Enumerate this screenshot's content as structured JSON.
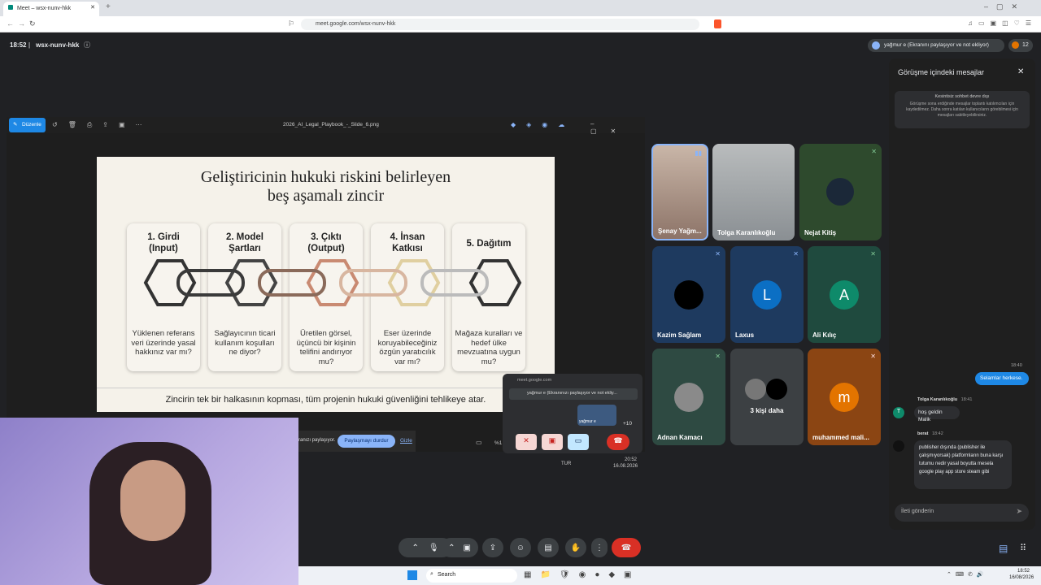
{
  "browser": {
    "tab_title": "Meet – wsx-nunv-hkk",
    "url": "meet.google.com/wsx-nunv-hkk"
  },
  "meet": {
    "time": "18:52",
    "meeting_code": "wsx-nunv-hkk",
    "presenter_pill": "yağmur e (Ekranını paylaşıyor ve not ekliyor)",
    "participant_count": "12"
  },
  "share_window": {
    "edit_label": "Düzenle",
    "file_name": "2026_AI_Legal_Playbook_-_Slide_6.png"
  },
  "slide": {
    "title_line1": "Geliştiricinin hukuki riskini belirleyen",
    "title_line2": "beş aşamalı zincir",
    "cards": [
      {
        "title": "1. Girdi\n(Input)",
        "question": "Yüklenen referans veri üzerinde yasal hakkınız var mı?"
      },
      {
        "title": "2. Model\nŞartları",
        "question": "Sağlayıcının ticari kullanım koşulları ne diyor?"
      },
      {
        "title": "3. Çıktı\n(Output)",
        "question": "Üretilen görsel, üçüncü bir kişinin telifini andırıyor mu?"
      },
      {
        "title": "4. İnsan\nKatkısı",
        "question": "Eser üzerinde koruyabileceğiniz özgün yaratıcılık var mı?"
      },
      {
        "title": "5. Dağıtım",
        "question": "Mağaza kuralları ve hedef ülke mevzuatına uygun mu?"
      }
    ],
    "footer": "Zincirin tek bir halkasının kopması, tüm projenin hukuki güvenliğini tehlikeye atar."
  },
  "sharebar": {
    "text": "ranızı paylaşıyor.",
    "stop_button": "Paylaşmayı durdur",
    "hide_button": "Gizle",
    "zoom": "%1"
  },
  "mini_popup": {
    "domain": "meet.google.com",
    "presenter": "yağmur e (Ekranınızı paylaşıyor ve not ekliy...",
    "self_label": "yağmur e",
    "more_count": "+10",
    "lang": "TUR",
    "time": "20:52",
    "date": "16.08.2026"
  },
  "tiles": [
    {
      "name": "Şenay Yağm...",
      "type": "video"
    },
    {
      "name": "Tolga Karanlıkoğlu",
      "type": "video"
    },
    {
      "name": "Nejat Kitiş",
      "type": "video"
    },
    {
      "name": "Kazim Sağlam",
      "type": "avatar",
      "initial": "",
      "color": "#000000"
    },
    {
      "name": "Laxus",
      "type": "avatar",
      "initial": "L",
      "color": "#0b6fc4"
    },
    {
      "name": "Ali Kılıç",
      "type": "avatar",
      "initial": "A",
      "color": "#0e8a6a"
    },
    {
      "name": "Adnan Kamacı",
      "type": "avatar",
      "initial": "",
      "color": "#7a7a7a"
    },
    {
      "name": "3 kişi daha",
      "type": "group"
    },
    {
      "name": "muhammed mali...",
      "type": "avatar",
      "initial": "m",
      "color": "#e37400"
    }
  ],
  "chat": {
    "title": "Görüşme içindeki mesajlar",
    "notice_head": "Kesintisiz sohbet devre dışı",
    "notice_body": "Görüşme sona erdiğinde mesajlar toplantı katılımcıları için kaydedilmez. Daha sonra katılan kullanıcıların görebilmesi için mesajları sabitleyebilirsiniz.",
    "self_time": "18:40",
    "self_msg": "Selamlar herkese.",
    "messages": [
      {
        "author": "Tolga Karanlıkoğlu",
        "time": "18:41",
        "text": "hoş geldin Malik"
      },
      {
        "author": "berat",
        "time": "18:42",
        "text": "publisher dışında (publisher ile çalışmıyorsak) platformların buna karşı tutumu nedir yasal boyutta mesela google play app store steam gibi"
      }
    ],
    "input_placeholder": "İleti gönderin"
  },
  "taskbar": {
    "search": "Search",
    "lang": "TUR",
    "time": "18:52",
    "date": "16/08/2026"
  }
}
